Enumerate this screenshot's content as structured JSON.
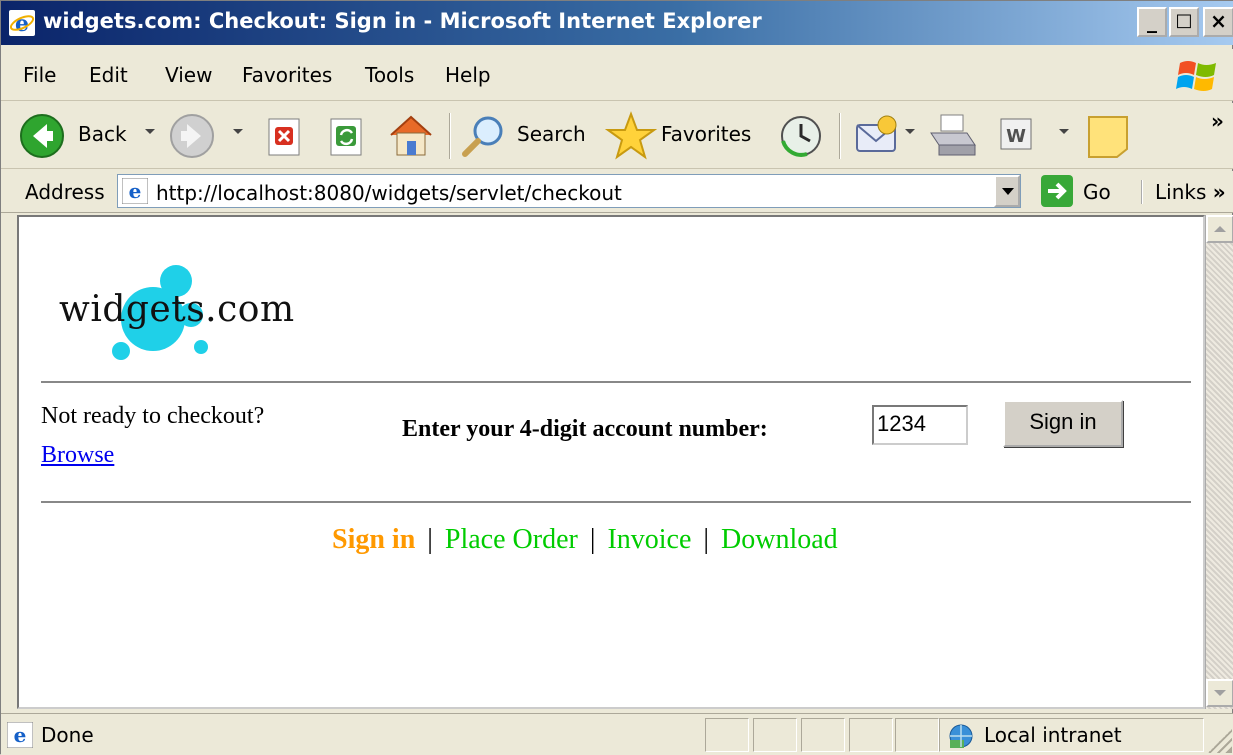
{
  "window": {
    "title": "widgets.com: Checkout: Sign in - Microsoft Internet Explorer",
    "controls": [
      "_",
      "□",
      "×"
    ]
  },
  "menu": [
    "File",
    "Edit",
    "View",
    "Favorites",
    "Tools",
    "Help"
  ],
  "toolbar": {
    "back_label": "Back",
    "search_label": "Search",
    "favorites_label": "Favorites",
    "overflow": "»"
  },
  "address": {
    "label": "Address",
    "url": "http://localhost:8080/widgets/servlet/checkout",
    "go_label": "Go",
    "links_label": "Links",
    "links_overflow": "»"
  },
  "page": {
    "logo_text": "widgets.com",
    "not_ready": "Not ready to checkout?",
    "browse_link": "Browse",
    "account_label": "Enter your 4-digit account number:",
    "account_value": "1234",
    "sign_in_button": "Sign in",
    "steps": [
      {
        "label": "Sign in",
        "color": "#ff9900",
        "current": true
      },
      {
        "label": "Place Order",
        "color": "#00cc00",
        "current": false
      },
      {
        "label": "Invoice",
        "color": "#00cc00",
        "current": false
      },
      {
        "label": "Download",
        "color": "#00cc00",
        "current": false
      }
    ],
    "step_separator": "|"
  },
  "status": {
    "text": "Done",
    "zone": "Local intranet"
  },
  "colors": {
    "logo_dots": "#1fd0e8",
    "link": "#0000ee",
    "current_step": "#ff9900",
    "future_step": "#00cc00"
  }
}
